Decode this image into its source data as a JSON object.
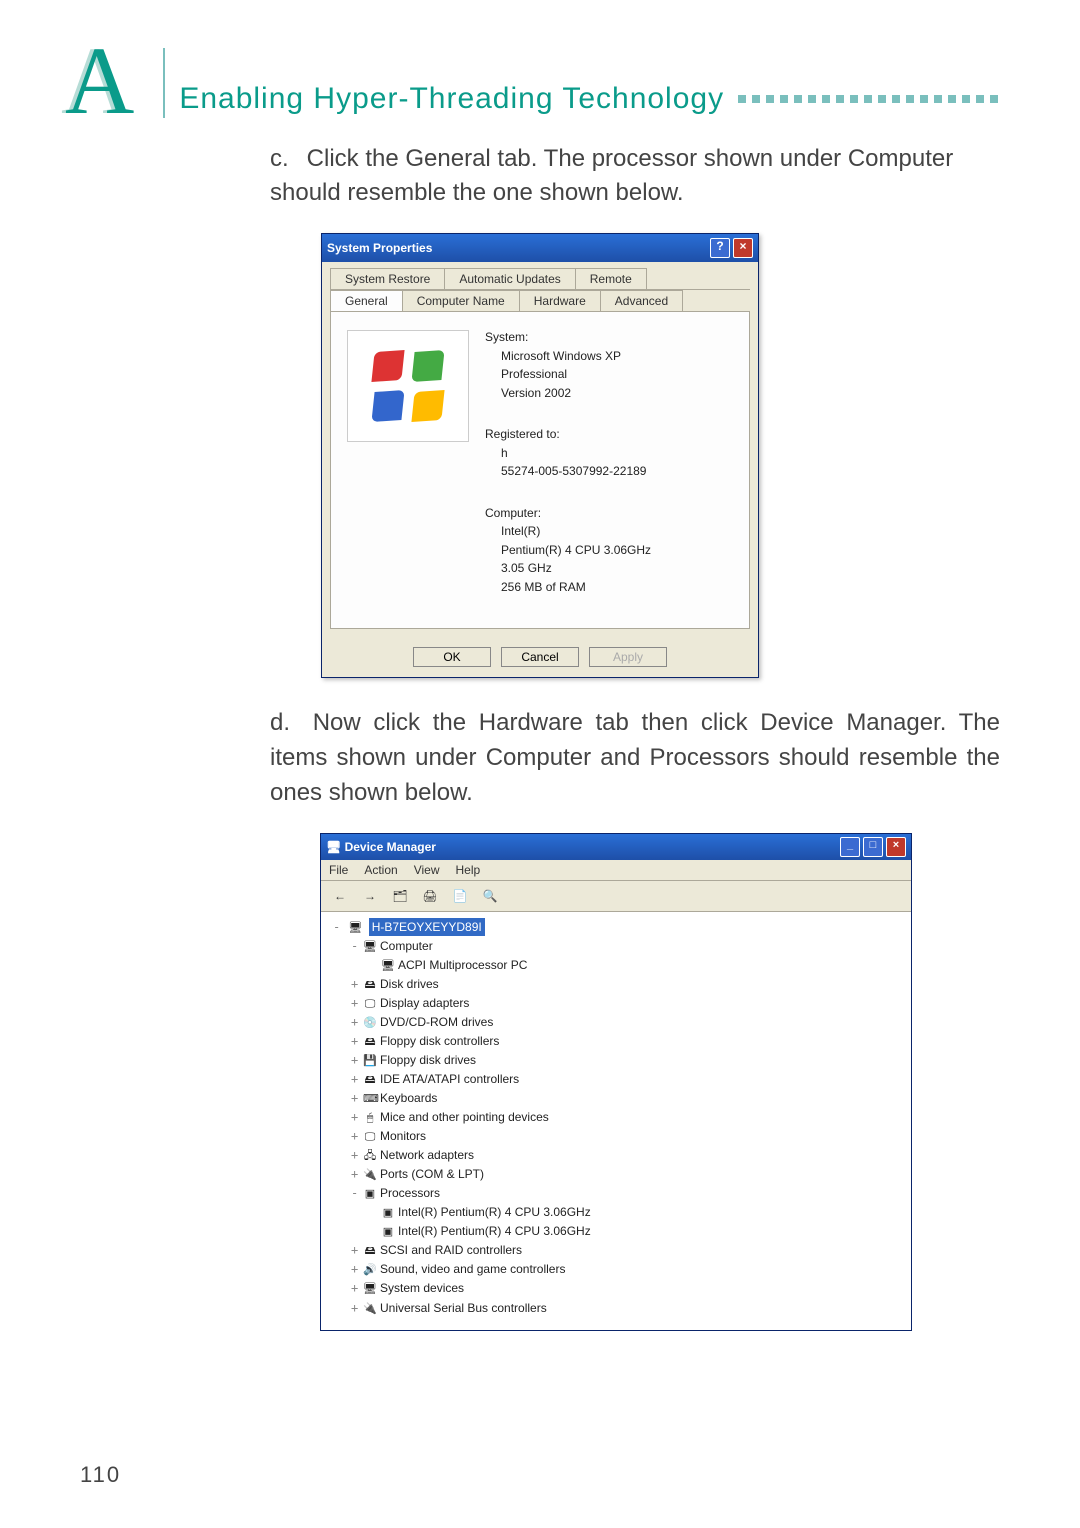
{
  "header": {
    "letter": "A",
    "title": "Enabling  Hyper-Threading  Technology"
  },
  "para_c": {
    "label": "c.",
    "text": "Click the General tab. The processor shown under Computer should resemble the one shown below."
  },
  "sysprops": {
    "title": "System Properties",
    "tabs_row1": [
      "System Restore",
      "Automatic Updates",
      "Remote"
    ],
    "tabs_row2": [
      "General",
      "Computer Name",
      "Hardware",
      "Advanced"
    ],
    "selected_tab": "General",
    "system_heading": "System:",
    "system_lines": [
      "Microsoft Windows XP",
      "Professional",
      "Version 2002"
    ],
    "registered_heading": "Registered to:",
    "registered_lines": [
      "h",
      "",
      "55274-005-5307992-22189"
    ],
    "computer_heading": "Computer:",
    "computer_lines": [
      "Intel(R)",
      "Pentium(R) 4 CPU 3.06GHz",
      "3.05 GHz",
      "256 MB of RAM"
    ],
    "buttons": {
      "ok": "OK",
      "cancel": "Cancel",
      "apply": "Apply"
    }
  },
  "para_d": {
    "label": "d.",
    "text": "Now click the Hardware tab then click Device Manager. The items shown under Computer and Processors should resemble the ones shown below."
  },
  "devmgr": {
    "title": "Device Manager",
    "menus": [
      "File",
      "Action",
      "View",
      "Help"
    ],
    "root": "H-B7EOYXEYYD89I",
    "items": [
      {
        "ind": 1,
        "exp": "-",
        "icon": "🖥",
        "label": "Computer"
      },
      {
        "ind": 2,
        "exp": " ",
        "icon": "🖥",
        "label": "ACPI Multiprocessor PC"
      },
      {
        "ind": 1,
        "exp": "+",
        "icon": "🖴",
        "label": "Disk drives"
      },
      {
        "ind": 1,
        "exp": "+",
        "icon": "🖵",
        "label": "Display adapters"
      },
      {
        "ind": 1,
        "exp": "+",
        "icon": "💿",
        "label": "DVD/CD-ROM drives"
      },
      {
        "ind": 1,
        "exp": "+",
        "icon": "🖴",
        "label": "Floppy disk controllers"
      },
      {
        "ind": 1,
        "exp": "+",
        "icon": "💾",
        "label": "Floppy disk drives"
      },
      {
        "ind": 1,
        "exp": "+",
        "icon": "🖴",
        "label": "IDE ATA/ATAPI controllers"
      },
      {
        "ind": 1,
        "exp": "+",
        "icon": "⌨",
        "label": "Keyboards"
      },
      {
        "ind": 1,
        "exp": "+",
        "icon": "🖱",
        "label": "Mice and other pointing devices"
      },
      {
        "ind": 1,
        "exp": "+",
        "icon": "🖵",
        "label": "Monitors"
      },
      {
        "ind": 1,
        "exp": "+",
        "icon": "🖧",
        "label": "Network adapters"
      },
      {
        "ind": 1,
        "exp": "+",
        "icon": "🔌",
        "label": "Ports (COM & LPT)"
      },
      {
        "ind": 1,
        "exp": "-",
        "icon": "▣",
        "label": "Processors"
      },
      {
        "ind": 2,
        "exp": " ",
        "icon": "▣",
        "label": "Intel(R) Pentium(R) 4 CPU 3.06GHz"
      },
      {
        "ind": 2,
        "exp": " ",
        "icon": "▣",
        "label": "Intel(R) Pentium(R) 4 CPU 3.06GHz"
      },
      {
        "ind": 1,
        "exp": "+",
        "icon": "🖴",
        "label": "SCSI and RAID controllers"
      },
      {
        "ind": 1,
        "exp": "+",
        "icon": "🔊",
        "label": "Sound, video and game controllers"
      },
      {
        "ind": 1,
        "exp": "+",
        "icon": "🖥",
        "label": "System devices"
      },
      {
        "ind": 1,
        "exp": "+",
        "icon": "🔌",
        "label": "Universal Serial Bus controllers"
      }
    ]
  },
  "page_number": "110"
}
